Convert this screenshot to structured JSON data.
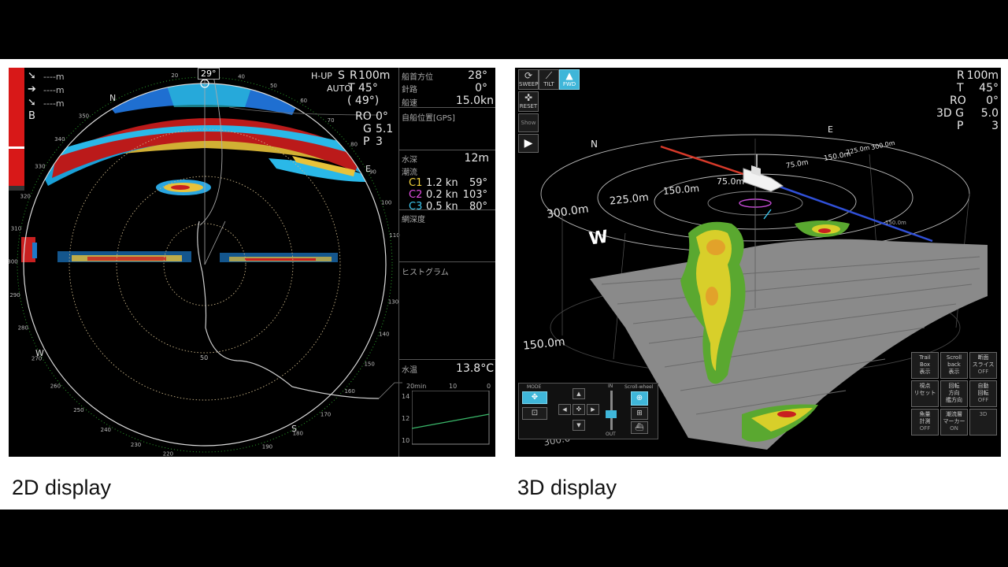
{
  "captions": {
    "left": "2D display",
    "right": "3D display"
  },
  "d2": {
    "mode": "H-UP",
    "auto": "AUTO",
    "s_label": "S",
    "r_label": "R",
    "range": "100m",
    "t_label": "T",
    "tilt": "45°",
    "tilt_paren": "( 49°)",
    "ro_label": "RO",
    "ro": "0°",
    "g_label": "G",
    "gain": "5.1",
    "p_label": "P",
    "pulse": "3",
    "bearing_top": "29°",
    "compass": {
      "n": "N",
      "e": "E",
      "w": "W",
      "s": "S"
    },
    "ring_labels": {
      "r50": "50",
      "r100": "100"
    },
    "ticks": [
      "20",
      "30",
      "40",
      "50",
      "60",
      "70",
      "80",
      "90",
      "100",
      "110",
      "120",
      "130",
      "140",
      "150",
      "160",
      "170",
      "180",
      "190",
      "200",
      "210",
      "220",
      "230",
      "240",
      "250",
      "260",
      "270",
      "280",
      "290",
      "300",
      "310",
      "320",
      "330",
      "340",
      "350"
    ],
    "markers": [
      {
        "value": "----m"
      },
      {
        "value": "----m"
      },
      {
        "value": "----m"
      },
      {
        "value": "B"
      }
    ],
    "info": {
      "heading_label": "船首方位",
      "heading": "28°",
      "course_label": "針路",
      "course": "0°",
      "speed_label": "船速",
      "speed": "15.0kn",
      "position_label": "自船位置[GPS]",
      "depth_label": "水深",
      "depth": "12m",
      "current_label": "潮流",
      "currents": [
        {
          "name": "C1",
          "speed": "1.2 kn",
          "dir": "59°",
          "color": "#f2d23c"
        },
        {
          "name": "C2",
          "speed": "0.2 kn",
          "dir": "103°",
          "color": "#e04ce0"
        },
        {
          "name": "C3",
          "speed": "0.5 kn",
          "dir": "80°",
          "color": "#3cc8f0"
        }
      ],
      "net_depth_label": "網深度",
      "histogram_label": "ヒストグラム",
      "water_temp_label": "水温",
      "water_temp": "13.8°C",
      "graph": {
        "x_labels": [
          "20min",
          "10",
          "0"
        ],
        "y_labels": [
          "14",
          "12",
          "10"
        ]
      }
    }
  },
  "d3": {
    "r_label": "R",
    "range": "100m",
    "t_label": "T",
    "tilt": "45°",
    "ro_label": "RO",
    "ro": "0°",
    "g_label": "3D G",
    "gain": "5.0",
    "p_label": "P",
    "pulse": "3",
    "compass": {
      "n": "N",
      "e": "E",
      "w": "W"
    },
    "distance_labels": [
      "300.0m",
      "225.0m",
      "150.0m",
      "75.0m",
      "75.0m",
      "150.0m",
      "225.0m",
      "300.0m",
      "150.0m",
      "150.0m",
      "300.0"
    ],
    "toolbar": {
      "sweep": "SWEEP",
      "tilt": "TILT",
      "fwd": "FWD",
      "reset": "RESET",
      "show": "Show"
    },
    "controls": {
      "mode": "MODE",
      "in": "IN",
      "out": "OUT",
      "scroll_wheel": "Scroll-wheel"
    },
    "buttons": [
      {
        "label": "Trail\nBox\n表示",
        "state": ""
      },
      {
        "label": "Scroll\nback\n表示",
        "state": ""
      },
      {
        "label": "断面\nスライス",
        "state": "OFF"
      },
      {
        "label": "視点\nリセット",
        "state": ""
      },
      {
        "label": "回転\n方向\n艦方向",
        "state": ""
      },
      {
        "label": "自動\n回転",
        "state": "OFF"
      },
      {
        "label": "魚量\n計測",
        "state": "OFF"
      },
      {
        "label": "潮流層\nマーカー",
        "state": "ON"
      },
      {
        "label": "",
        "state": "3D"
      }
    ]
  }
}
